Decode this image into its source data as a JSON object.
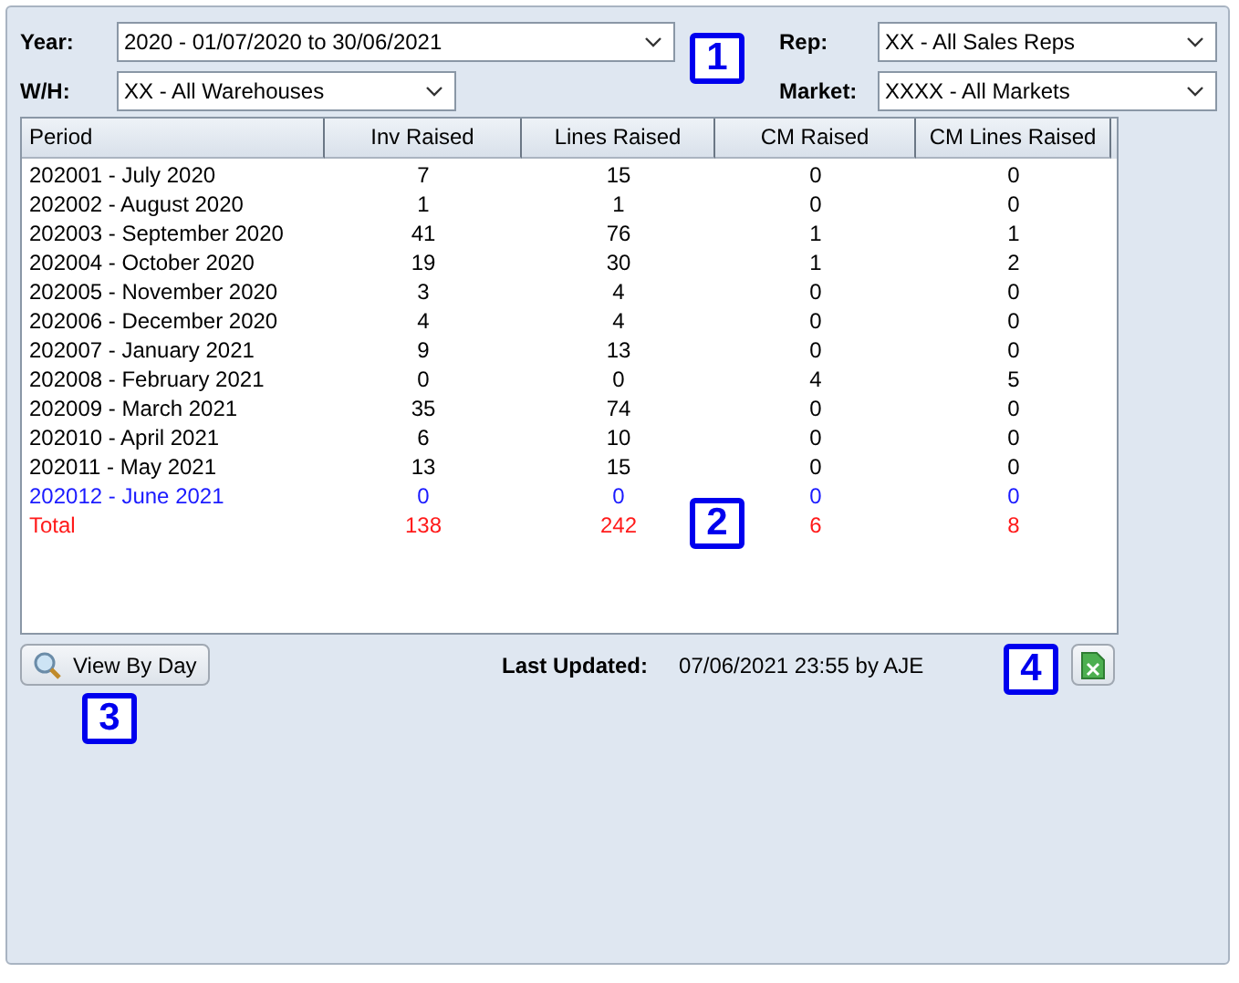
{
  "filters": [
    {
      "label": "Year:",
      "value": "2020 - 01/07/2020 to 30/06/2021"
    },
    {
      "label": "Rep:",
      "value": "XX - All Sales Reps"
    },
    {
      "label": "W/H:",
      "value": "XX - All Warehouses"
    },
    {
      "label": "Market:",
      "value": "XXXX - All Markets"
    }
  ],
  "table": {
    "columns": [
      "Period",
      "Inv Raised",
      "Lines Raised",
      "CM Raised",
      "CM Lines Raised"
    ],
    "rows": [
      {
        "kind": "normal",
        "cells": [
          "202001 - July 2020",
          "7",
          "15",
          "0",
          "0"
        ]
      },
      {
        "kind": "normal",
        "cells": [
          "202002 - August 2020",
          "1",
          "1",
          "0",
          "0"
        ]
      },
      {
        "kind": "normal",
        "cells": [
          "202003 - September 2020",
          "41",
          "76",
          "1",
          "1"
        ]
      },
      {
        "kind": "normal",
        "cells": [
          "202004 - October 2020",
          "19",
          "30",
          "1",
          "2"
        ]
      },
      {
        "kind": "normal",
        "cells": [
          "202005 - November 2020",
          "3",
          "4",
          "0",
          "0"
        ]
      },
      {
        "kind": "normal",
        "cells": [
          "202006 - December 2020",
          "4",
          "4",
          "0",
          "0"
        ]
      },
      {
        "kind": "normal",
        "cells": [
          "202007 - January 2021",
          "9",
          "13",
          "0",
          "0"
        ]
      },
      {
        "kind": "normal",
        "cells": [
          "202008 - February 2021",
          "0",
          "0",
          "4",
          "5"
        ]
      },
      {
        "kind": "normal",
        "cells": [
          "202009 - March 2021",
          "35",
          "74",
          "0",
          "0"
        ]
      },
      {
        "kind": "normal",
        "cells": [
          "202010 - April 2021",
          "6",
          "10",
          "0",
          "0"
        ]
      },
      {
        "kind": "normal",
        "cells": [
          "202011 - May 2021",
          "13",
          "15",
          "0",
          "0"
        ]
      },
      {
        "kind": "current",
        "cells": [
          "202012 - June 2021",
          "0",
          "0",
          "0",
          "0"
        ]
      },
      {
        "kind": "total",
        "cells": [
          "Total",
          "138",
          "242",
          "6",
          "8"
        ]
      }
    ]
  },
  "view_button": {
    "label": "View By Day"
  },
  "last_updated": {
    "label": "Last Updated:",
    "value": "07/06/2021 23:55 by AJE"
  },
  "callouts": [
    "1",
    "2",
    "3",
    "4"
  ]
}
